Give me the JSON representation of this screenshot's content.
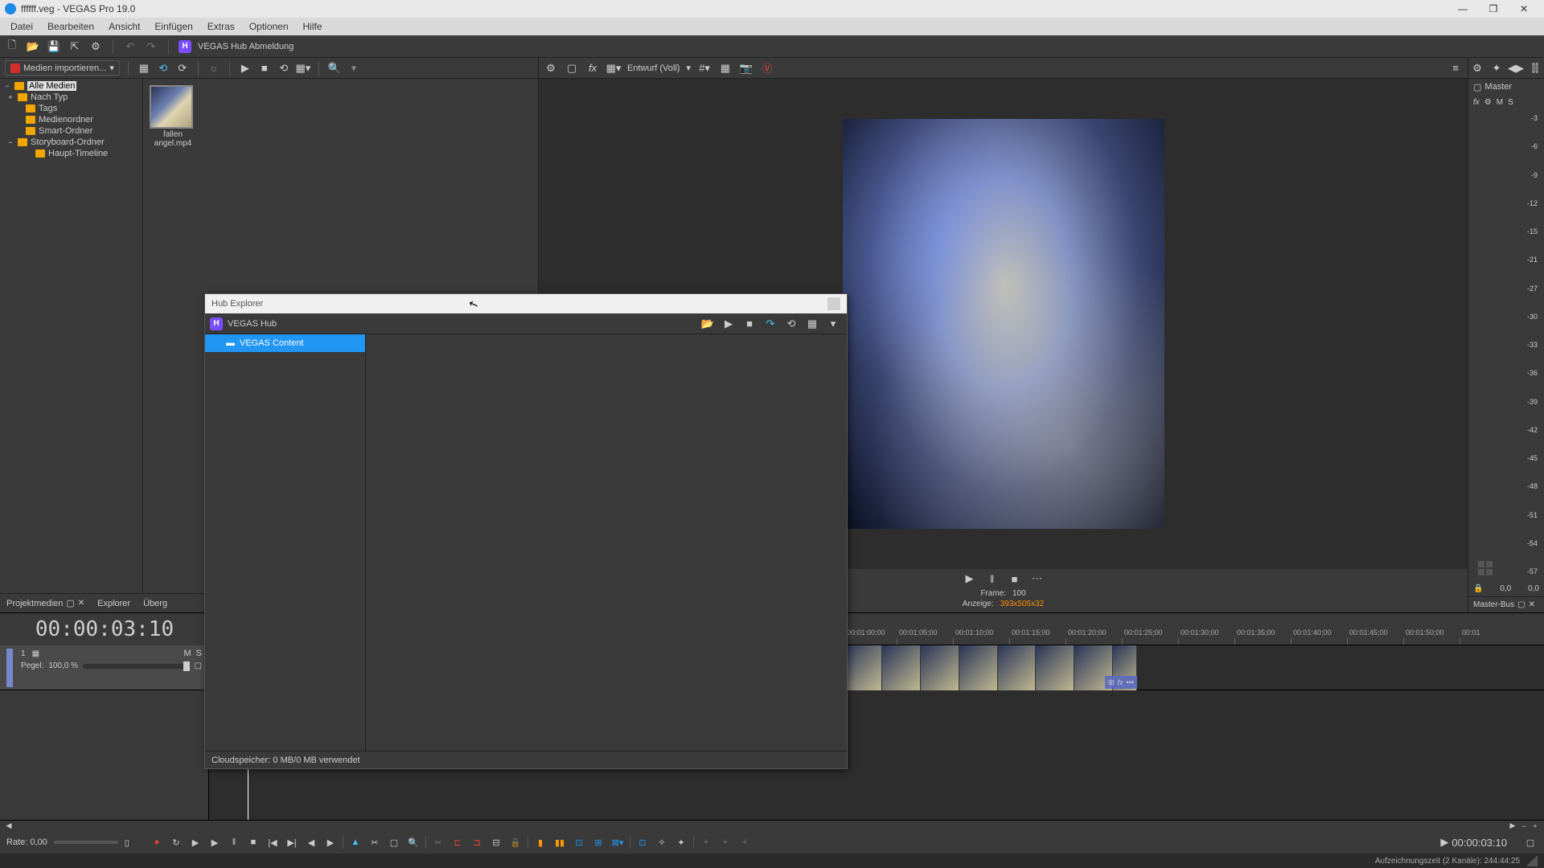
{
  "title": "ffffff.veg - VEGAS Pro 19.0",
  "menu": [
    "Datei",
    "Bearbeiten",
    "Ansicht",
    "Einfügen",
    "Extras",
    "Optionen",
    "Hilfe"
  ],
  "toolbar": {
    "hub_label": "VEGAS Hub Abmeldung",
    "import_label": "Medien importieren...",
    "quality_label": "Entwurf (Voll)"
  },
  "media_tree": [
    {
      "label": "Alle Medien",
      "level": 0,
      "selected": true,
      "expand": "−"
    },
    {
      "label": "Nach Typ",
      "level": 0,
      "expand": "+"
    },
    {
      "label": "Tags",
      "level": 0,
      "expand": ""
    },
    {
      "label": "Medienordner",
      "level": 0,
      "expand": ""
    },
    {
      "label": "Smart-Ordner",
      "level": 0,
      "expand": ""
    },
    {
      "label": "Storyboard-Ordner",
      "level": 0,
      "expand": "−"
    },
    {
      "label": "Haupt-Timeline",
      "level": 1,
      "expand": ""
    }
  ],
  "media_thumb": {
    "label": "fallen angel.mp4"
  },
  "left_tabs": [
    "Projektmedien",
    "Explorer",
    "Überg"
  ],
  "preview": {
    "frame_label": "Frame:",
    "frame_value": "100",
    "display_label": "Anzeige:",
    "display_value": "393x505x32"
  },
  "master": {
    "label": "Master",
    "sub": [
      "fx",
      "⚙",
      "M",
      "S"
    ],
    "scale": [
      "-3",
      "-6",
      "-9",
      "-12",
      "-15",
      "-21",
      "-27",
      "-30",
      "-33",
      "-36",
      "-39",
      "-42",
      "-45",
      "-48",
      "-51",
      "-54",
      "-57"
    ],
    "footer": [
      "0,0",
      "0,0"
    ],
    "tab": "Master-Bus"
  },
  "hub": {
    "title": "Hub Explorer",
    "root": "VEGAS Hub",
    "content": "VEGAS Content",
    "footer": "Cloudspeicher: 0 MB/0 MB verwendet"
  },
  "timeline": {
    "timecode": "00:00:03:10",
    "ruler_ticks": [
      "00:01:00;00",
      "00:01:05;00",
      "00:01:10;00",
      "00:01:15;00",
      "00:01:20;00",
      "00:01:25;00",
      "00:01:30;00",
      "00:01:35;00",
      "00:01:40;00",
      "00:01:45;00",
      "00:01:50;00",
      "00:01"
    ],
    "track": {
      "num": "1",
      "pegel_label": "Pegel:",
      "pegel_value": "100,0 %",
      "m": "M",
      "s": "S",
      "fx": "fx",
      "more": "•••"
    }
  },
  "transport": {
    "rate_label": "Rate: 0,00",
    "timecode": "00:00:03:10"
  },
  "statusbar": "Aufzeichnungszeit (2 Kanäle): 244:44:25"
}
